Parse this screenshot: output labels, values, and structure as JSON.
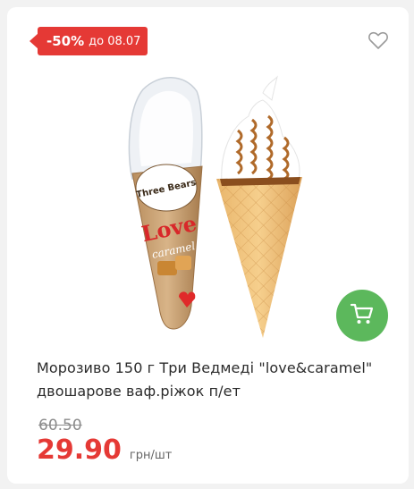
{
  "product": {
    "discount": {
      "percent": "-50%",
      "until": "до 08.07"
    },
    "image_alt": "Three Bears love caramel ice cream cone",
    "brand_on_pack": {
      "brand": "Three Bears",
      "line1": "Love",
      "line2": "caramel"
    },
    "title": "Морозиво 150 г Три Ведмеді \"love&caramel\" двошарове ваф.ріжок п/ет",
    "old_price": "60.50",
    "price": "29.90",
    "unit": "грн/шт"
  },
  "icons": {
    "favorite": "heart-outline-icon",
    "cart": "shopping-cart-icon"
  },
  "colors": {
    "accent_red": "#e53935",
    "cart_green": "#5cb85c"
  }
}
